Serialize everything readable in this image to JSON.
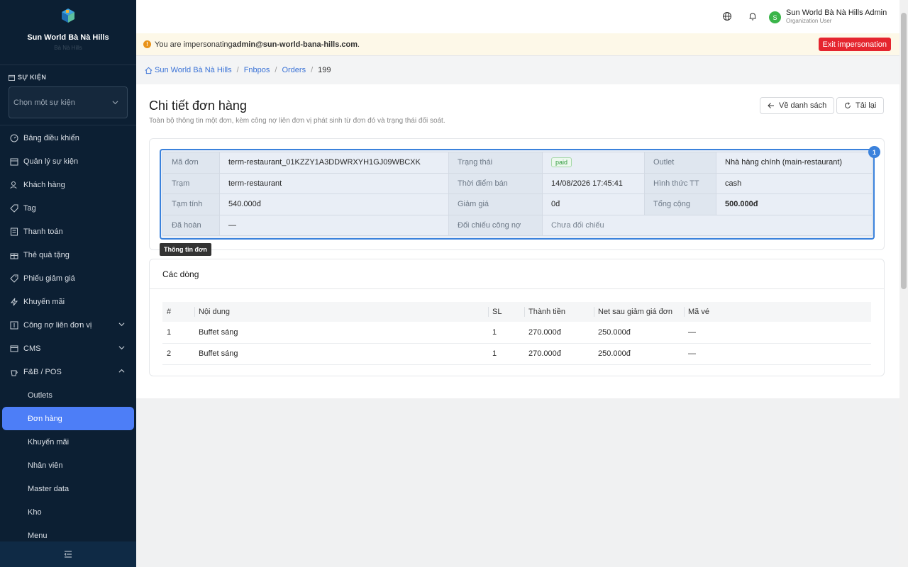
{
  "sidebar": {
    "org_name": "Sun World Bà Nà Hills",
    "org_sub": "Bà Nà Hills",
    "section_label": "SỰ KIỆN",
    "event_select_placeholder": "Chọn một sự kiện",
    "items": [
      {
        "label": "Bảng điều khiển"
      },
      {
        "label": "Quản lý sự kiện"
      },
      {
        "label": "Khách hàng"
      },
      {
        "label": "Tag"
      },
      {
        "label": "Thanh toán"
      },
      {
        "label": "Thẻ quà tặng"
      },
      {
        "label": "Phiếu giảm giá"
      },
      {
        "label": "Khuyến mãi"
      },
      {
        "label": "Công nợ liên đơn vị"
      },
      {
        "label": "CMS"
      },
      {
        "label": "F&B / POS"
      }
    ],
    "sub_items": [
      {
        "label": "Outlets"
      },
      {
        "label": "Đơn hàng"
      },
      {
        "label": "Khuyến mãi"
      },
      {
        "label": "Nhân viên"
      },
      {
        "label": "Master data"
      },
      {
        "label": "Kho"
      },
      {
        "label": "Menu"
      }
    ]
  },
  "topbar": {
    "avatar_letter": "S",
    "user_name": "Sun World Bà Nà Hills Admin",
    "user_role": "Organization User"
  },
  "banner": {
    "prefix": "You are impersonating ",
    "email": "admin@sun-world-bana-hills.com",
    "suffix": ".",
    "exit_label": "Exit impersonation"
  },
  "breadcrumb": {
    "home": "Sun World Bà Nà Hills",
    "c1": "Fnbpos",
    "c2": "Orders",
    "current": "199",
    "sep": "/"
  },
  "page": {
    "title": "Chi tiết đơn hàng",
    "description": "Toàn bộ thông tin một đơn, kèm công nợ liên đơn vị phát sinh từ đơn đó và trạng thái đối soát.",
    "back_label": "Về danh sách",
    "reload_label": "Tải lại"
  },
  "order_info": {
    "marker": "1",
    "tag": "Thông tin đơn",
    "rows": [
      {
        "l1": "Mã đơn",
        "v1": "term-restaurant_01KZZY1A3DDWRXYH1GJ09WBCXK",
        "l2": "Trạng thái",
        "v2": "paid",
        "l3": "Outlet",
        "v3": "Nhà hàng chính (main-restaurant)"
      },
      {
        "l1": "Trạm",
        "v1": "term-restaurant",
        "l2": "Thời điểm bán",
        "v2": "14/08/2026 17:45:41",
        "l3": "Hình thức TT",
        "v3": "cash"
      },
      {
        "l1": "Tạm tính",
        "v1": "540.000đ",
        "l2": "Giảm giá",
        "v2": "0đ",
        "l3": "Tổng cộng",
        "v3": "500.000đ"
      },
      {
        "l1": "Đã hoàn",
        "v1": "—",
        "l2": "Đối chiếu công nợ",
        "v2": "Chưa đối chiếu"
      }
    ]
  },
  "lines": {
    "title": "Các dòng",
    "headers": [
      "#",
      "Nội dung",
      "SL",
      "Thành tiền",
      "Net sau giảm giá đơn",
      "Mã vé"
    ],
    "rows": [
      [
        "1",
        "Buffet sáng",
        "1",
        "270.000đ",
        "250.000đ",
        "—"
      ],
      [
        "2",
        "Buffet sáng",
        "1",
        "270.000đ",
        "250.000đ",
        "—"
      ]
    ]
  },
  "colors": {
    "sidebar_bg": "#0c1f33",
    "accent": "#4d7ef7",
    "danger": "#e5252e",
    "success": "#2f9a3c"
  }
}
